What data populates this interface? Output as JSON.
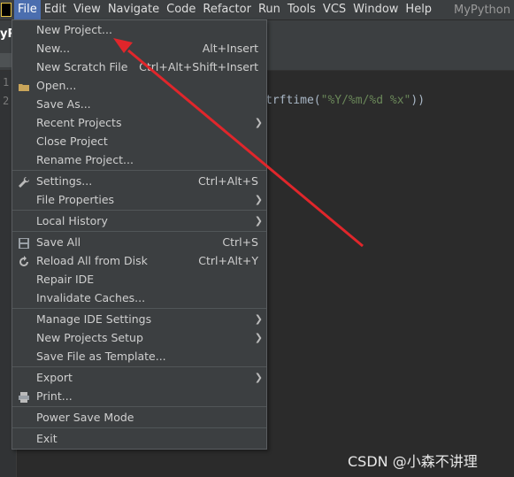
{
  "menubar": {
    "items": [
      "File",
      "Edit",
      "View",
      "Navigate",
      "Code",
      "Refactor",
      "Run",
      "Tools",
      "VCS",
      "Window",
      "Help"
    ],
    "window_title": "MyPython"
  },
  "project_crumb": "yP",
  "editor": {
    "line_numbers": [
      "1",
      "2"
    ],
    "code_prefix": "trftime(",
    "code_string": "\"%Y/%m/%d %x\"",
    "code_suffix": "))"
  },
  "file_menu": [
    {
      "label": "New Project...",
      "shortcut": "",
      "submenu": false
    },
    {
      "label": "New...",
      "shortcut": "Alt+Insert",
      "submenu": false
    },
    {
      "label": "New Scratch File",
      "shortcut": "Ctrl+Alt+Shift+Insert",
      "submenu": false
    },
    {
      "label": "Open...",
      "shortcut": "",
      "submenu": false,
      "icon": "folder-icon"
    },
    {
      "label": "Save As...",
      "shortcut": "",
      "submenu": false
    },
    {
      "label": "Recent Projects",
      "shortcut": "",
      "submenu": true
    },
    {
      "label": "Close Project",
      "shortcut": "",
      "submenu": false
    },
    {
      "label": "Rename Project...",
      "shortcut": "",
      "submenu": false
    },
    {
      "sep": true
    },
    {
      "label": "Settings...",
      "shortcut": "Ctrl+Alt+S",
      "submenu": false,
      "icon": "wrench-icon"
    },
    {
      "label": "File Properties",
      "shortcut": "",
      "submenu": true
    },
    {
      "sep": true
    },
    {
      "label": "Local History",
      "shortcut": "",
      "submenu": true
    },
    {
      "sep": true
    },
    {
      "label": "Save All",
      "shortcut": "Ctrl+S",
      "submenu": false,
      "icon": "save-icon"
    },
    {
      "label": "Reload All from Disk",
      "shortcut": "Ctrl+Alt+Y",
      "submenu": false,
      "icon": "reload-icon"
    },
    {
      "label": "Repair IDE",
      "shortcut": "",
      "submenu": false
    },
    {
      "label": "Invalidate Caches...",
      "shortcut": "",
      "submenu": false
    },
    {
      "sep": true
    },
    {
      "label": "Manage IDE Settings",
      "shortcut": "",
      "submenu": true
    },
    {
      "label": "New Projects Setup",
      "shortcut": "",
      "submenu": true
    },
    {
      "label": "Save File as Template...",
      "shortcut": "",
      "submenu": false
    },
    {
      "sep": true
    },
    {
      "label": "Export",
      "shortcut": "",
      "submenu": true
    },
    {
      "label": "Print...",
      "shortcut": "",
      "submenu": false,
      "icon": "printer-icon"
    },
    {
      "sep": true
    },
    {
      "label": "Power Save Mode",
      "shortcut": "",
      "submenu": false
    },
    {
      "sep": true
    },
    {
      "label": "Exit",
      "shortcut": "",
      "submenu": false
    }
  ],
  "submenu_glyph": "❯",
  "watermark": "CSDN @小森不讲理",
  "colors": {
    "accent": "#4b6eaf",
    "annotation_arrow": "#e0262b"
  }
}
